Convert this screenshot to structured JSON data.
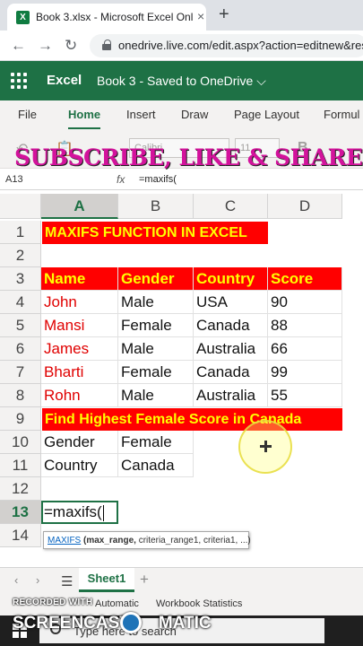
{
  "browser": {
    "tab_title": "Book 3.xlsx - Microsoft Excel Onl",
    "tab_icon_letter": "X",
    "close_glyph": "×",
    "new_tab_glyph": "+",
    "back_glyph": "←",
    "forward_glyph": "→",
    "reload_glyph": "↻",
    "url": "onedrive.live.com/edit.aspx?action=editnew&res"
  },
  "app": {
    "name": "Excel",
    "document_title": "Book 3 - Saved to OneDrive ⌵"
  },
  "ribbon": {
    "tabs": [
      {
        "label": "File",
        "active": false
      },
      {
        "label": "Home",
        "active": true
      },
      {
        "label": "Insert",
        "active": false
      },
      {
        "label": "Draw",
        "active": false
      },
      {
        "label": "Page Layout",
        "active": false
      },
      {
        "label": "Formul",
        "active": false
      }
    ],
    "font_name": "Calibri",
    "font_size": "11",
    "undo_glyph": "↶",
    "paste_glyph": "📋",
    "bold_glyph": "B"
  },
  "overlay": {
    "promo_text": "SUBSCRIBE, LIKE & SHARE"
  },
  "formula_bar": {
    "name_box": "A13",
    "fx_label": "fx",
    "formula": "=maxifs("
  },
  "grid": {
    "columns": [
      "A",
      "B",
      "C",
      "D"
    ],
    "selected_column": "A",
    "rows": [
      "1",
      "2",
      "3",
      "4",
      "5",
      "6",
      "7",
      "8",
      "9",
      "10",
      "11",
      "12",
      "13",
      "14"
    ],
    "selected_row": "13",
    "title_banner": "MAXIFS FUNCTION IN EXCEL",
    "headers": [
      "Name",
      "Gender",
      "Country",
      "Score"
    ],
    "data": [
      [
        "John",
        "Male",
        "USA",
        "90"
      ],
      [
        "Mansi",
        "Female",
        "Canada",
        "88"
      ],
      [
        "James",
        "Male",
        "Australia",
        "66"
      ],
      [
        "Bharti",
        "Female",
        "Canada",
        "99"
      ],
      [
        "Rohn",
        "Male",
        "Australia",
        "55"
      ]
    ],
    "question_banner": "Find Highest Female Score in Canada",
    "criteria": [
      [
        "Gender",
        "Female"
      ],
      [
        "Country",
        "Canada"
      ]
    ],
    "active_cell_text": "=maxifs("
  },
  "tooltip": {
    "function_name": "MAXIFS",
    "arg_bold": " (max_range,",
    "args_rest": " criteria_range1, criteria1, ...)"
  },
  "sheets": {
    "nav_prev": "‹",
    "nav_next": "›",
    "menu_glyph": "☰",
    "active": "Sheet1",
    "add_glyph": "+"
  },
  "status": {
    "mode": "Automatic",
    "workbook_stats": "Workbook Statistics"
  },
  "taskbar": {
    "search_placeholder": "Type here to search"
  },
  "watermark": {
    "top": "RECORDED WITH",
    "bottom_left": "SCREENCAST",
    "bottom_right": "MATIC"
  },
  "colors": {
    "excel_green": "#1e7145",
    "banner_red": "#ff0000",
    "banner_text_yellow": "#ffff00",
    "name_red": "#e00000",
    "promo_magenta": "#d3139c"
  }
}
